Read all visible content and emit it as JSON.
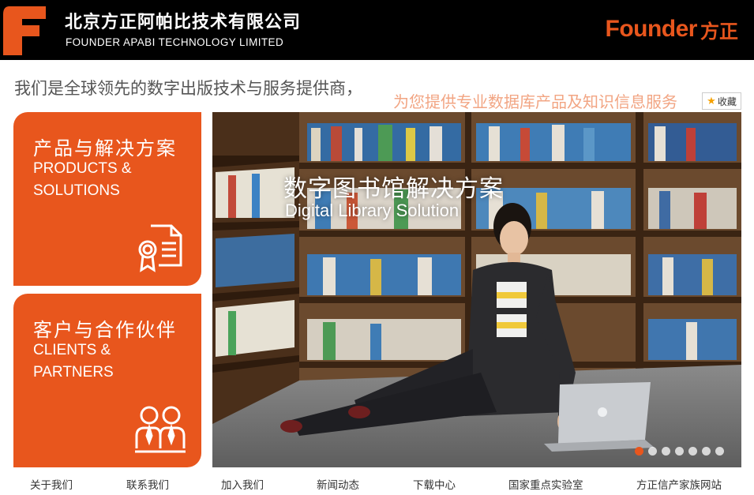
{
  "header": {
    "company_name_cn": "北京方正阿帕比技术有限公司",
    "company_name_en": "FOUNDER APABI TECHNOLOGY LIMITED",
    "brand_en": "Founder",
    "brand_cn": "方正",
    "logo_icon": "founder-f-logo"
  },
  "tagline": {
    "text": "我们是全球领先的数字出版技术与服务提供商，",
    "ticker": "为您提供专业数据库产品及知识信息服务"
  },
  "favorite": {
    "label": "收藏",
    "icon": "star-icon"
  },
  "tiles": {
    "products": {
      "cn": "产品与解决方案",
      "en_line1": "PRODUCTS &",
      "en_line2": "SOLUTIONS",
      "icon": "certificate-document-icon"
    },
    "clients": {
      "cn": "客户与合作伙伴",
      "en_line1": "CLIENTS &",
      "en_line2": "PARTNERS",
      "icon": "partners-people-icon"
    }
  },
  "banner": {
    "title_cn": "数字图书馆解决方案",
    "title_en": "Digital Library Solution",
    "slide_count": 7,
    "active_slide": 1
  },
  "footer_nav": [
    {
      "label": "关于我们"
    },
    {
      "label": "联系我们"
    },
    {
      "label": "加入我们"
    },
    {
      "label": "新闻动态"
    },
    {
      "label": "下载中心"
    },
    {
      "label": "国家重点实验室"
    },
    {
      "label": "方正信产家族网站"
    }
  ],
  "colors": {
    "accent": "#e8561d",
    "header_bg": "#000000",
    "ticker": "#f2a583"
  }
}
